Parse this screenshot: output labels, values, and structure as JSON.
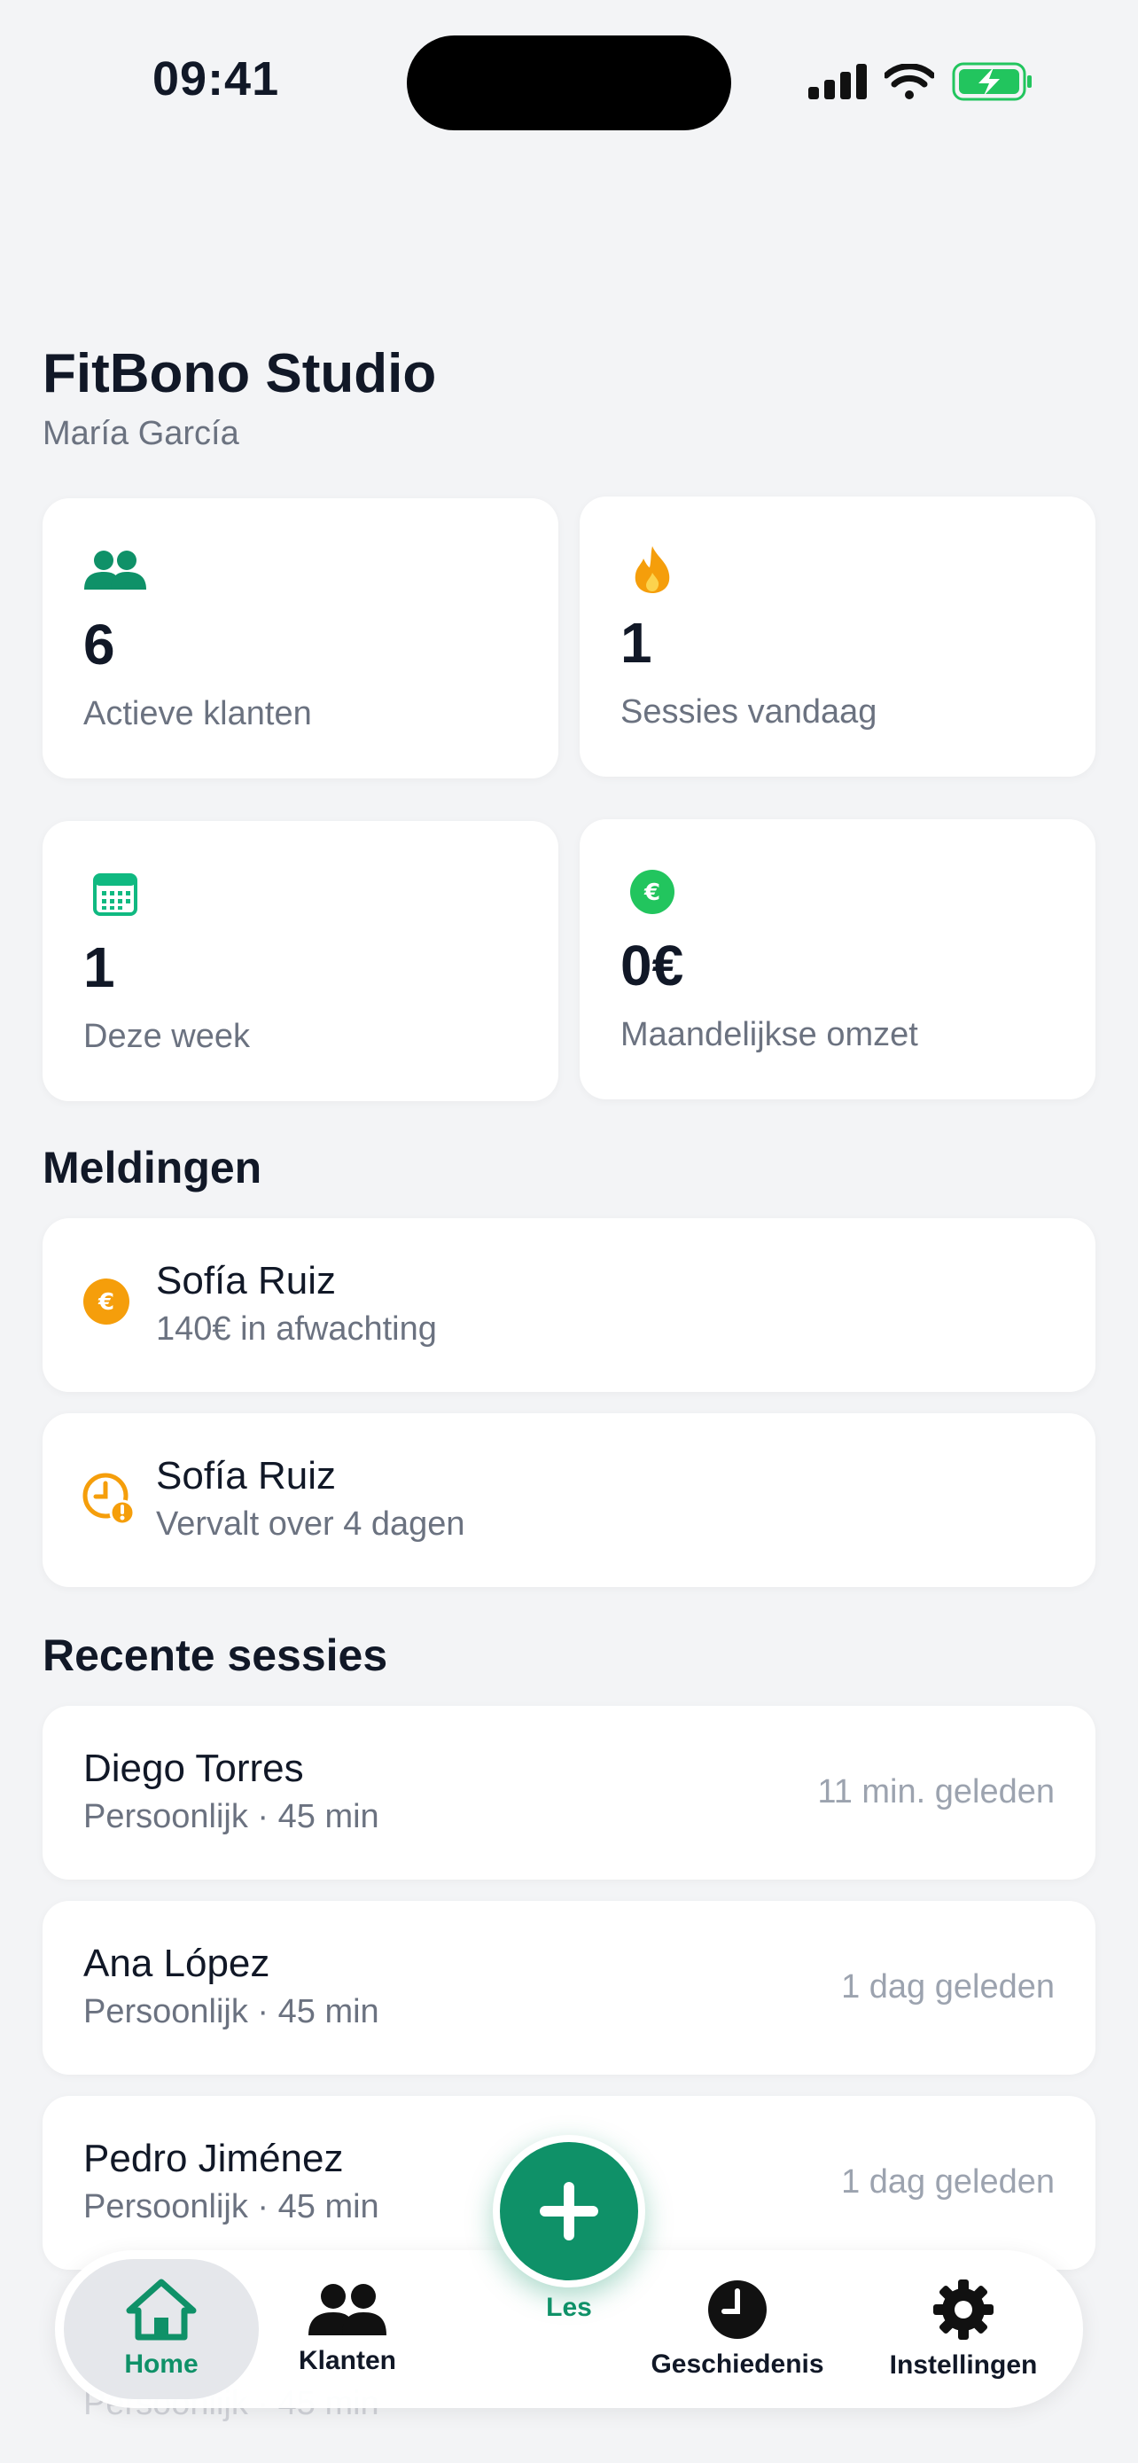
{
  "status_bar": {
    "time": "09:41"
  },
  "header": {
    "title": "FitBono Studio",
    "subtitle": "María García"
  },
  "stats": [
    {
      "icon": "users-icon",
      "value": "6",
      "label": "Actieve klanten",
      "color": "#0f9168"
    },
    {
      "icon": "flame-icon",
      "value": "1",
      "label": "Sessies vandaag",
      "color": "#f59e0b"
    },
    {
      "icon": "calendar-icon",
      "value": "1",
      "label": "Deze week",
      "color": "#10b981"
    },
    {
      "icon": "euro-icon",
      "value": "0€",
      "label": "Maandelijkse omzet",
      "color": "#22c55e"
    }
  ],
  "notifications": {
    "title": "Meldingen",
    "items": [
      {
        "icon": "euro-coin-icon",
        "name": "Sofía Ruiz",
        "detail": "140€ in afwachting"
      },
      {
        "icon": "clock-warning-icon",
        "name": "Sofía Ruiz",
        "detail": "Vervalt over 4 dagen"
      }
    ]
  },
  "recent_sessions": {
    "title": "Recente sessies",
    "items": [
      {
        "name": "Diego Torres",
        "detail": "Persoonlijk · 45 min",
        "time": "11 min. geleden"
      },
      {
        "name": "Ana López",
        "detail": "Persoonlijk · 45 min",
        "time": "1 dag geleden"
      },
      {
        "name": "Pedro Jiménez",
        "detail": "Persoonlijk · 45 min",
        "time": "1 dag geleden"
      },
      {
        "detail": "Persoonlijk · 45 min"
      }
    ]
  },
  "nav": {
    "home": "Home",
    "clients": "Klanten",
    "add": "Les",
    "history": "Geschiedenis",
    "settings": "Instellingen"
  },
  "colors": {
    "accent": "#0f9168",
    "warning": "#f59e0b"
  }
}
